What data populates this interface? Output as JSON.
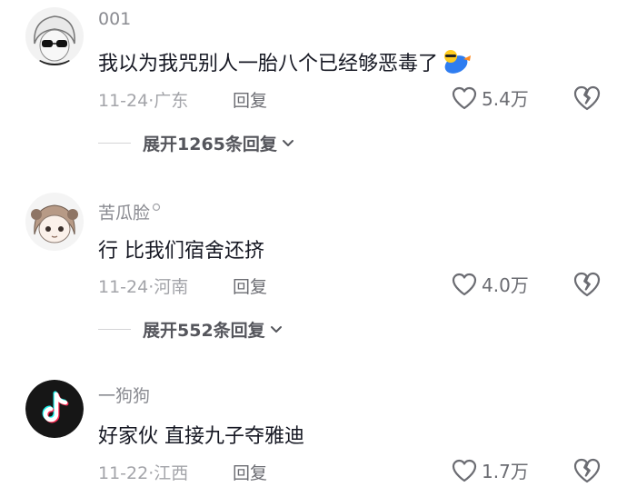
{
  "comments": [
    {
      "username": "001",
      "text": "我以为我咒别人一胎八个已经够恶毒了",
      "date": "11-24",
      "location": "广东",
      "reply_label": "回复",
      "likes": "5.4万",
      "expand_label": "展开1265条回复"
    },
    {
      "username": "苦瓜脸",
      "text": "行 比我们宿舍还挤",
      "date": "11-24",
      "location": "河南",
      "reply_label": "回复",
      "likes": "4.0万",
      "expand_label": "展开552条回复"
    },
    {
      "username": "一狗狗",
      "text": "好家伙 直接九子夺雅迪",
      "date": "11-22",
      "location": "江西",
      "reply_label": "回复",
      "likes": "1.7万"
    }
  ],
  "meta_separator": "·",
  "icons": {
    "like": "heart-outline-icon",
    "dislike": "broken-heart-icon",
    "expand": "chevron-down-icon",
    "emoji": "sunglasses-emoji-icon",
    "avatar3": "tiktok-logo-icon"
  },
  "colors": {
    "text_primary": "#161823",
    "text_secondary": "#8a8b91",
    "text_meta": "#a3a4a9",
    "action": "#6b6c72"
  }
}
